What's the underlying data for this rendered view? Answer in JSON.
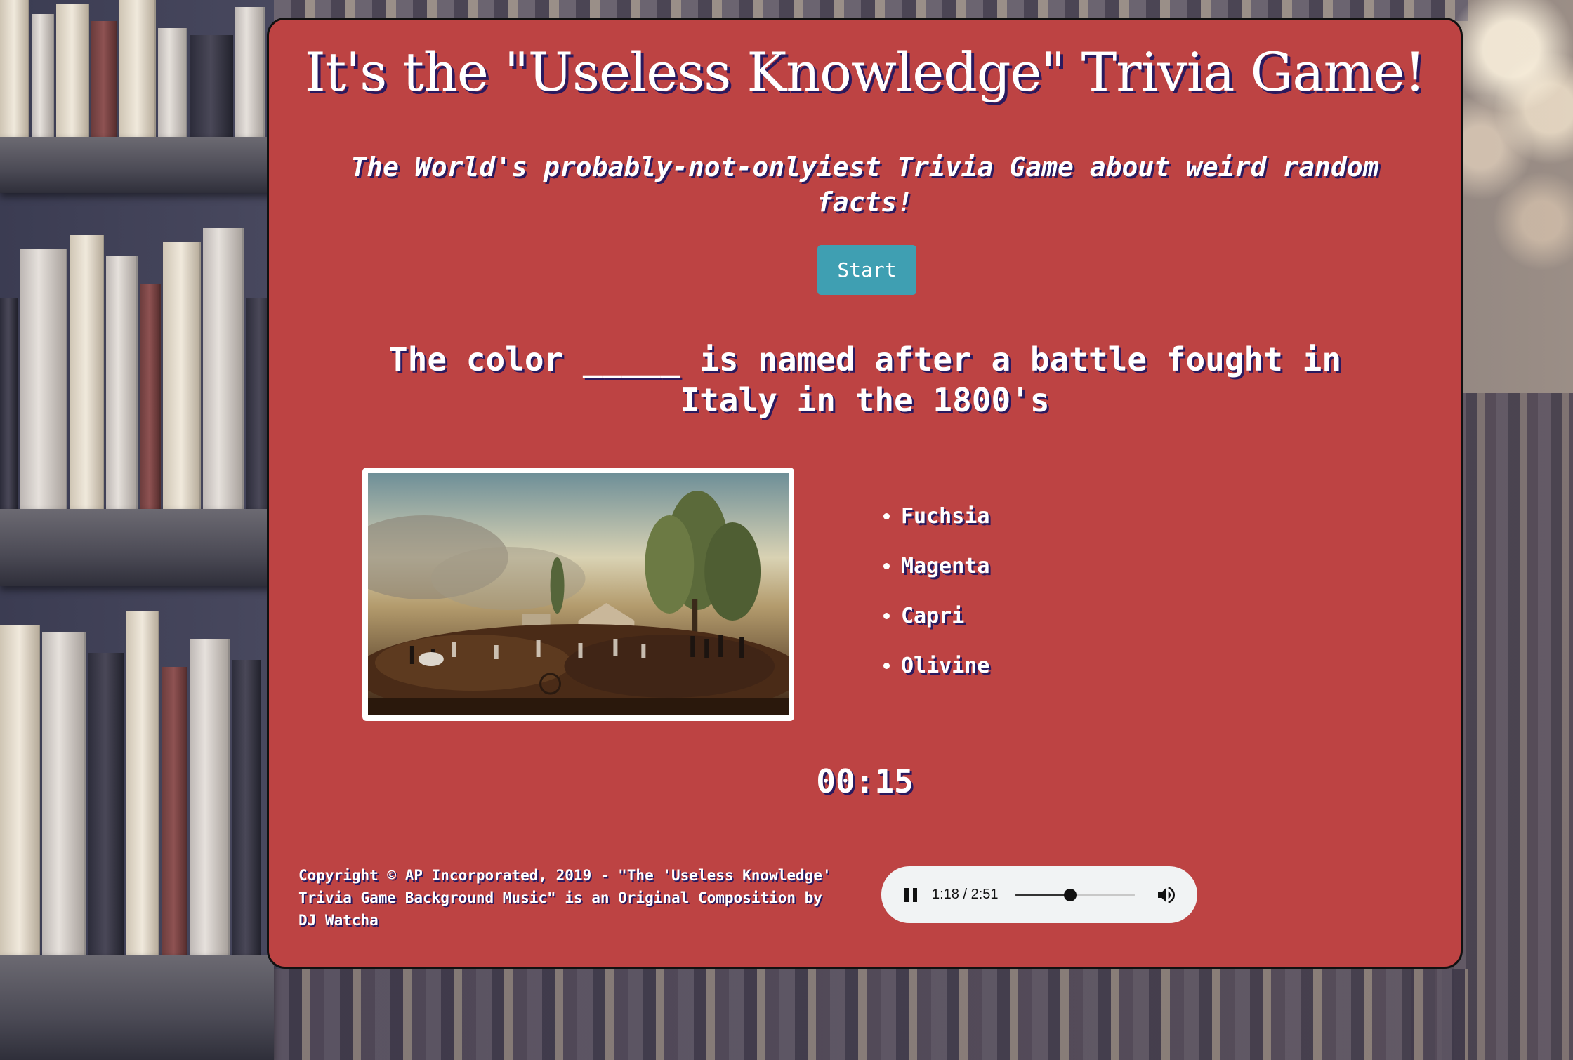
{
  "page": {
    "title": "It's the \"Useless Knowledge\" Trivia Game!",
    "subtitle": "The World's probably-not-onlyiest Trivia Game about weird random facts!",
    "start_label": "Start"
  },
  "question": {
    "text": "The color _____ is named after a battle fought in Italy in the 1800's",
    "image_icon": "battle-painting"
  },
  "answers": [
    {
      "label": "Fuchsia"
    },
    {
      "label": "Magenta"
    },
    {
      "label": "Capri"
    },
    {
      "label": "Olivine"
    }
  ],
  "timer": {
    "value": "00:15"
  },
  "footer": {
    "copyright": "Copyright © AP Incorporated, 2019 - \"The 'Useless Knowledge' Trivia Game Background Music\" is an Original Composition by DJ Watcha"
  },
  "audio": {
    "time_display": "1:18 / 2:51",
    "progress_fraction": 0.46,
    "play_state_icon": "pause-icon",
    "volume_icon": "volume-icon"
  },
  "colors": {
    "card_background": "#bd4343",
    "button_background": "#3f9fb2",
    "text_shadow": "#2a1a5e",
    "audio_background": "#f1f3f4"
  }
}
